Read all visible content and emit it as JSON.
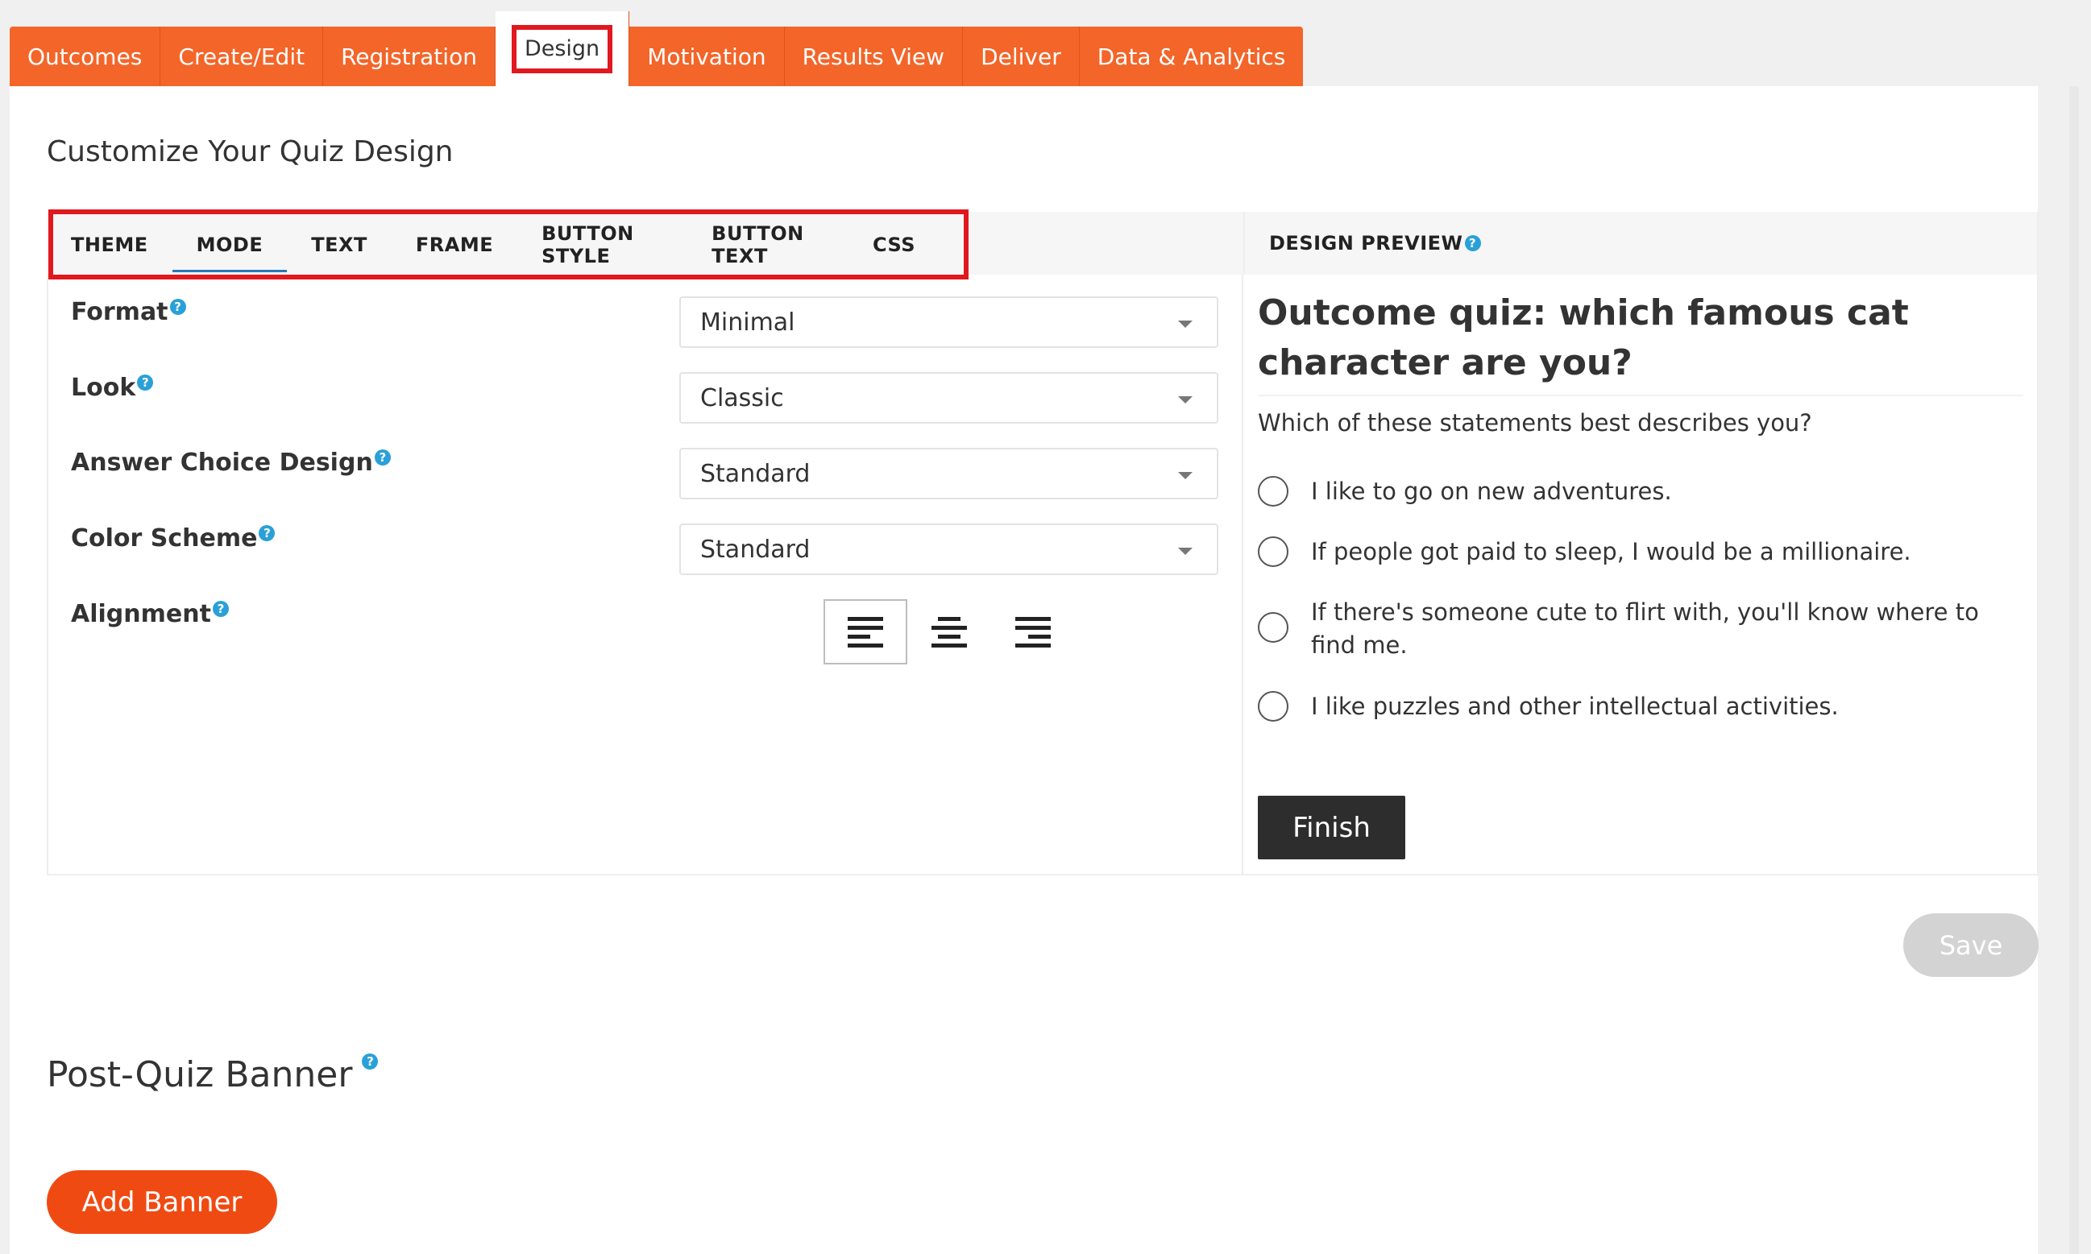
{
  "topnav": {
    "tabs": [
      "Outcomes",
      "Create/Edit",
      "Registration",
      "Design",
      "Motivation",
      "Results View",
      "Deliver",
      "Data & Analytics"
    ],
    "active": "Design"
  },
  "design": {
    "title": "Customize Your Quiz Design",
    "subtabs": [
      "THEME",
      "MODE",
      "TEXT",
      "FRAME",
      "BUTTON STYLE",
      "BUTTON TEXT",
      "CSS"
    ],
    "active_subtab": "MODE",
    "fields": {
      "format": {
        "label": "Format",
        "value": "Minimal"
      },
      "look": {
        "label": "Look",
        "value": "Classic"
      },
      "answer_choice": {
        "label": "Answer Choice Design",
        "value": "Standard"
      },
      "color_scheme": {
        "label": "Color Scheme",
        "value": "Standard"
      },
      "alignment": {
        "label": "Alignment",
        "options": [
          "left",
          "center",
          "right"
        ],
        "selected": "left"
      }
    },
    "help_glyph": "?"
  },
  "preview": {
    "header": "DESIGN PREVIEW",
    "quiz_title": "Outcome quiz: which famous cat character are you?",
    "question": "Which of these statements best describes you?",
    "answers": [
      "I like to go on new adventures.",
      "If people got paid to sleep, I would be a millionaire.",
      "If there's someone cute to flirt with, you'll know where to find me.",
      "I like puzzles and other intellectual activities."
    ],
    "finish_label": "Finish"
  },
  "save_label": "Save",
  "banner": {
    "title": "Post-Quiz Banner",
    "add_label": "Add Banner"
  },
  "colors": {
    "brand_orange": "#f36529",
    "highlight_red": "#e0191f",
    "help_blue": "#2aa0d8"
  }
}
